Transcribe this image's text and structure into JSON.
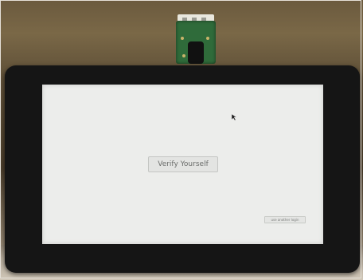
{
  "screen": {
    "verify_button_label": "Verify Yourself",
    "alt_login_label": "use another login"
  },
  "icons": {
    "cursor": "mouse-pointer-icon",
    "camera": "camera-module-icon"
  },
  "colors": {
    "screen_background": "#ecedeb",
    "bezel": "#151515",
    "camera_board": "#2f6b3a"
  }
}
